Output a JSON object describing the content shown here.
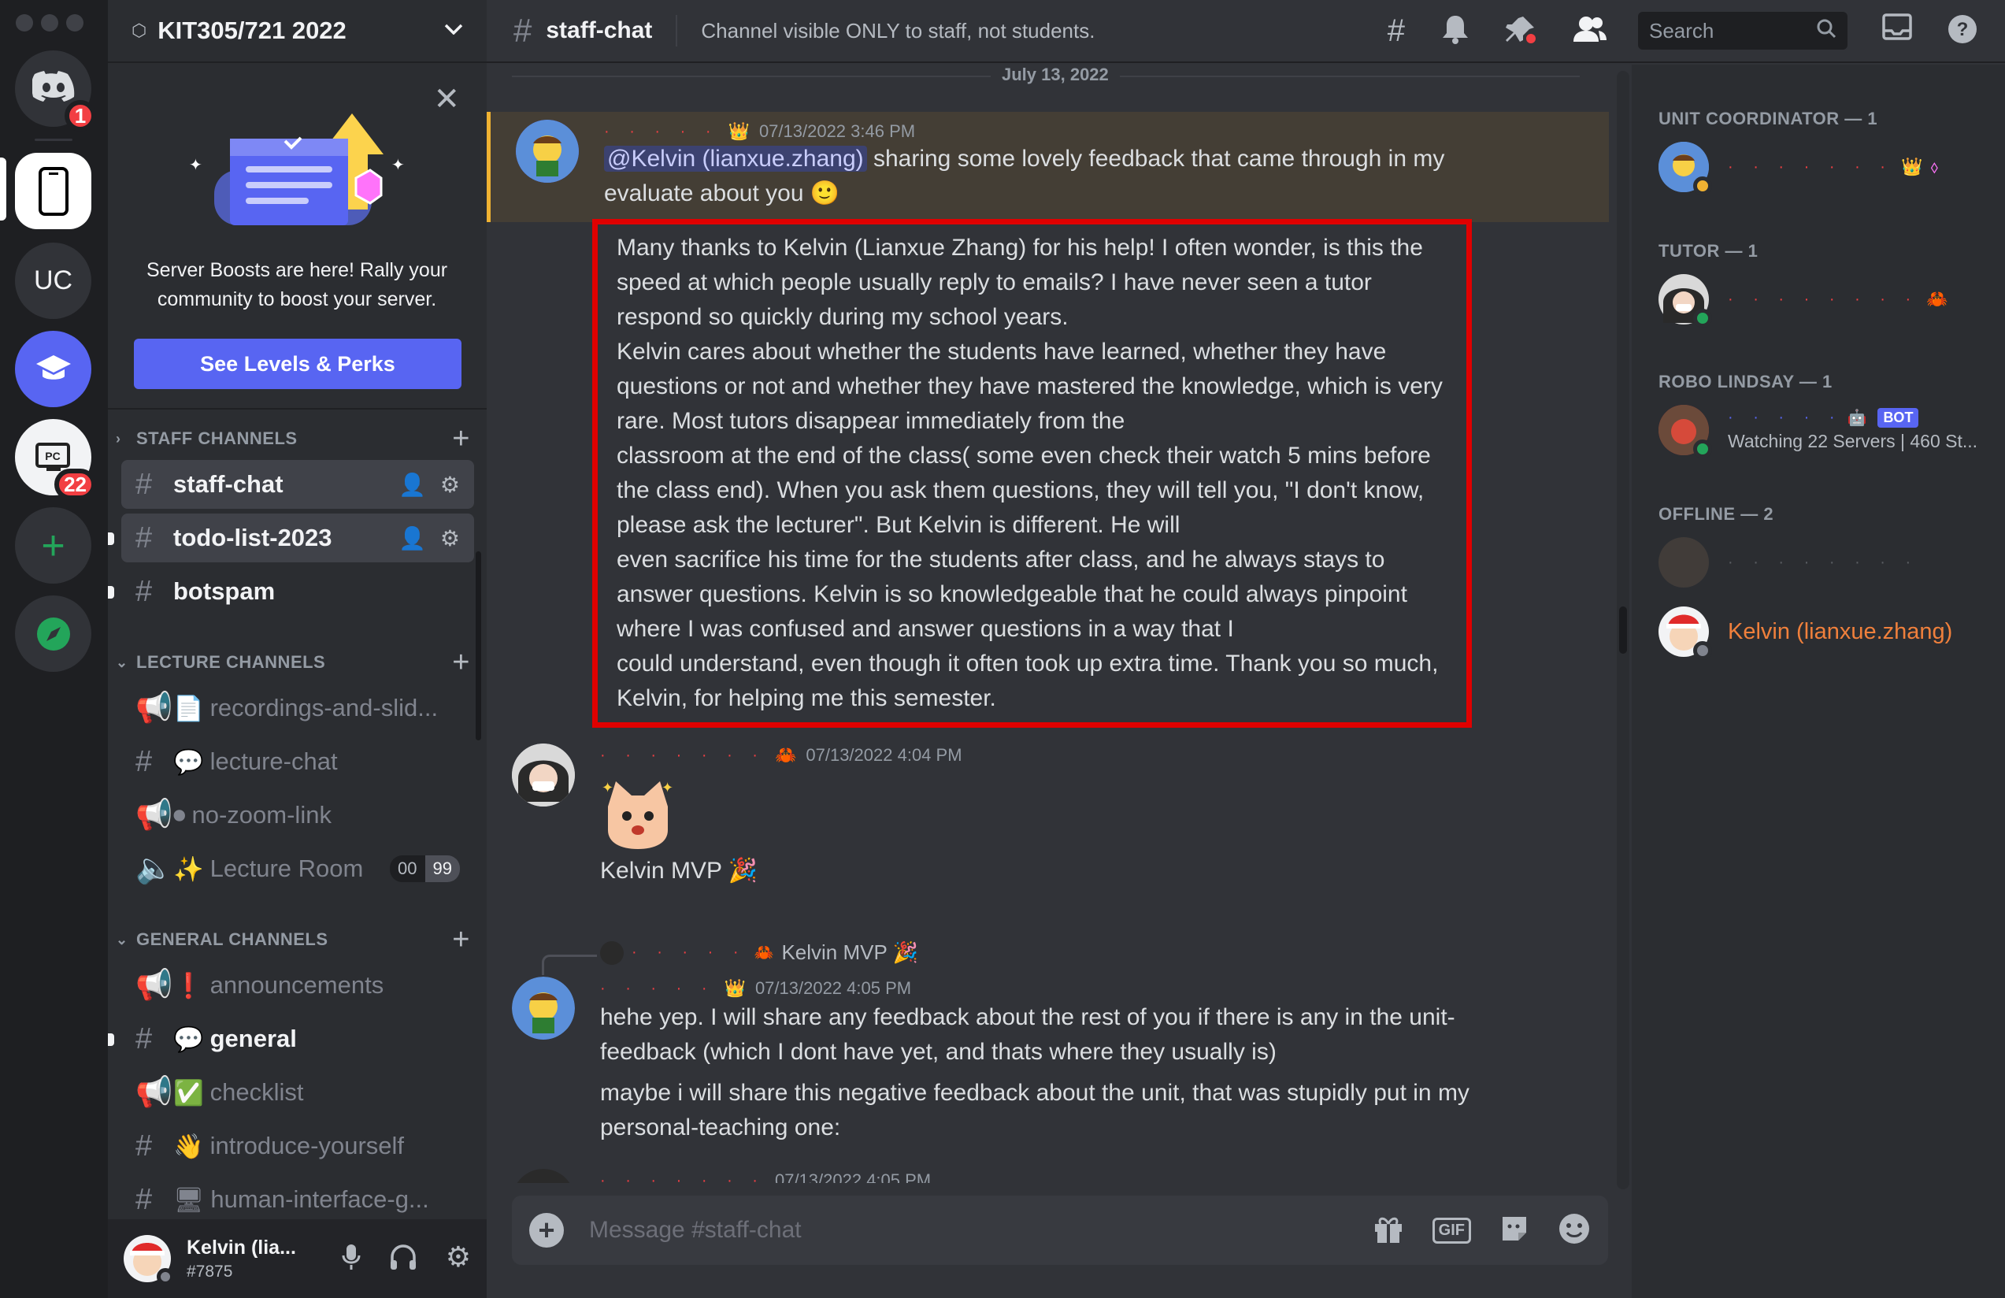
{
  "server": {
    "name": "KIT305/721 2022",
    "rail_badges": {
      "dm": "1",
      "progr_club": "22"
    },
    "uc_label": "UC"
  },
  "boost": {
    "text": "Server Boosts are here! Rally your community to boost your server.",
    "button": "See Levels & Perks"
  },
  "categories": {
    "staff": "STAFF CHANNELS",
    "lecture": "LECTURE CHANNELS",
    "general": "GENERAL CHANNELS"
  },
  "channels": {
    "staff_chat": "staff-chat",
    "todo": "todo-list-2023",
    "botspam": "botspam",
    "recordings": "recordings-and-slid...",
    "lecture_chat": "lecture-chat",
    "no_zoom": "no-zoom-link",
    "lecture_room": "Lecture Room",
    "lecture_room_count_a": "00",
    "lecture_room_count_b": "99",
    "announcements": "announcements",
    "general": "general",
    "checklist": "checklist",
    "introduce": "introduce-yourself",
    "human_interface": "human-interface-g..."
  },
  "user_panel": {
    "name": "Kelvin (lia...",
    "tag": "#7875"
  },
  "header": {
    "channel": "staff-chat",
    "topic": "Channel visible ONLY to staff, not students.",
    "search_placeholder": "Search"
  },
  "messages": {
    "date_divider": "July 13, 2022",
    "m1": {
      "timestamp": "07/13/2022 3:46 PM",
      "mention": "@Kelvin (lianxue.zhang)",
      "text": " sharing some lovely feedback that came through in my evaluate about you 🙂",
      "quote": "Many thanks to Kelvin (Lianxue Zhang) for his help! I often wonder, is this the speed at which people usually reply to emails? I have never seen a tutor respond so quickly during my school years.\nKelvin cares about whether the students have learned, whether they have questions or not and whether they have mastered the knowledge, which is very rare. Most tutors disappear immediately from the\nclassroom at the end of the class( some even check their watch 5 mins before the class end). When you ask them questions, they will tell you, \"I don't know, please ask the lecturer\". But Kelvin is different. He will\neven sacrifice his time for the students after class, and he always stays to answer questions. Kelvin is so knowledgeable that he could always pinpoint where I was confused and answer questions in a way that I\ncould understand, even though it often took up extra time. Thank you so much, Kelvin, for helping me this semester."
    },
    "m2": {
      "timestamp": "07/13/2022 4:04 PM",
      "text": "Kelvin MVP 🎉"
    },
    "m3": {
      "reply_preview": "Kelvin MVP 🎉",
      "timestamp": "07/13/2022 4:05 PM",
      "line1": "hehe yep. I will share any feedback about the rest of you if there is any in the unit-feedback (which I dont have yet, and thats where they usually is)",
      "line2": "maybe i will share this negative feedback about the unit, that was stupidly put in my personal-teaching one:"
    },
    "m4": {
      "timestamp": "07/13/2022 4:05 PM"
    }
  },
  "composer": {
    "placeholder": "Message #staff-chat",
    "gif": "GIF"
  },
  "members": {
    "unit_coordinator": "UNIT COORDINATOR — 1",
    "tutor": "TUTOR — 1",
    "robo": "ROBO LINDSAY — 1",
    "robo_activity": "Watching 22 Servers | 460 St...",
    "bot_tag": "BOT",
    "offline": "OFFLINE — 2",
    "kelvin": "Kelvin (lianxue.zhang)"
  },
  "colors": {
    "accent": "#5865f2",
    "highlight_box": "#e00000",
    "kelvin_name": "#f0803c",
    "mention_bar": "#f0b232"
  }
}
